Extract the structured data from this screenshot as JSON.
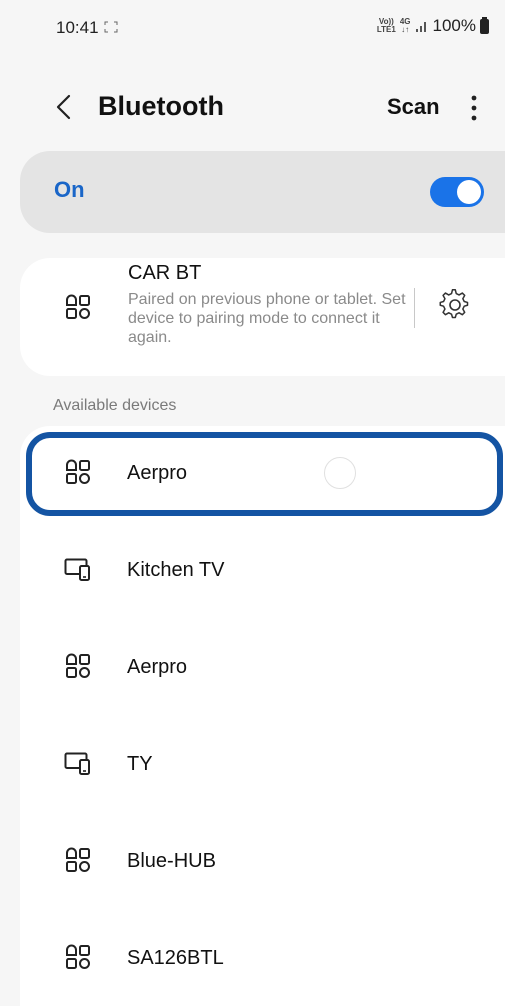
{
  "status_bar": {
    "time": "10:41",
    "volte_top": "Vo))",
    "volte_bottom": "LTE1",
    "network": "4G",
    "network_arrows": "↓↑",
    "battery": "100%"
  },
  "header": {
    "title": "Bluetooth",
    "scan_label": "Scan"
  },
  "bluetooth_toggle": {
    "label": "On",
    "state": "on",
    "accent_color": "#1a73e8"
  },
  "paired_device": {
    "name": "CAR BT",
    "description": "Paired on previous phone or tablet. Set device to pairing mode to connect it again.",
    "icon": "device-grid-icon"
  },
  "available_section": {
    "label": "Available devices"
  },
  "available_devices": [
    {
      "name": "Aerpro",
      "icon": "device-grid-icon",
      "focused": true,
      "connecting": true
    },
    {
      "name": "Kitchen TV",
      "icon": "tv-phone-icon"
    },
    {
      "name": "Aerpro",
      "icon": "device-grid-icon"
    },
    {
      "name": "TY",
      "icon": "tv-phone-icon"
    },
    {
      "name": "Blue-HUB",
      "icon": "device-grid-icon"
    },
    {
      "name": "SA126BTL",
      "icon": "device-grid-icon"
    }
  ]
}
